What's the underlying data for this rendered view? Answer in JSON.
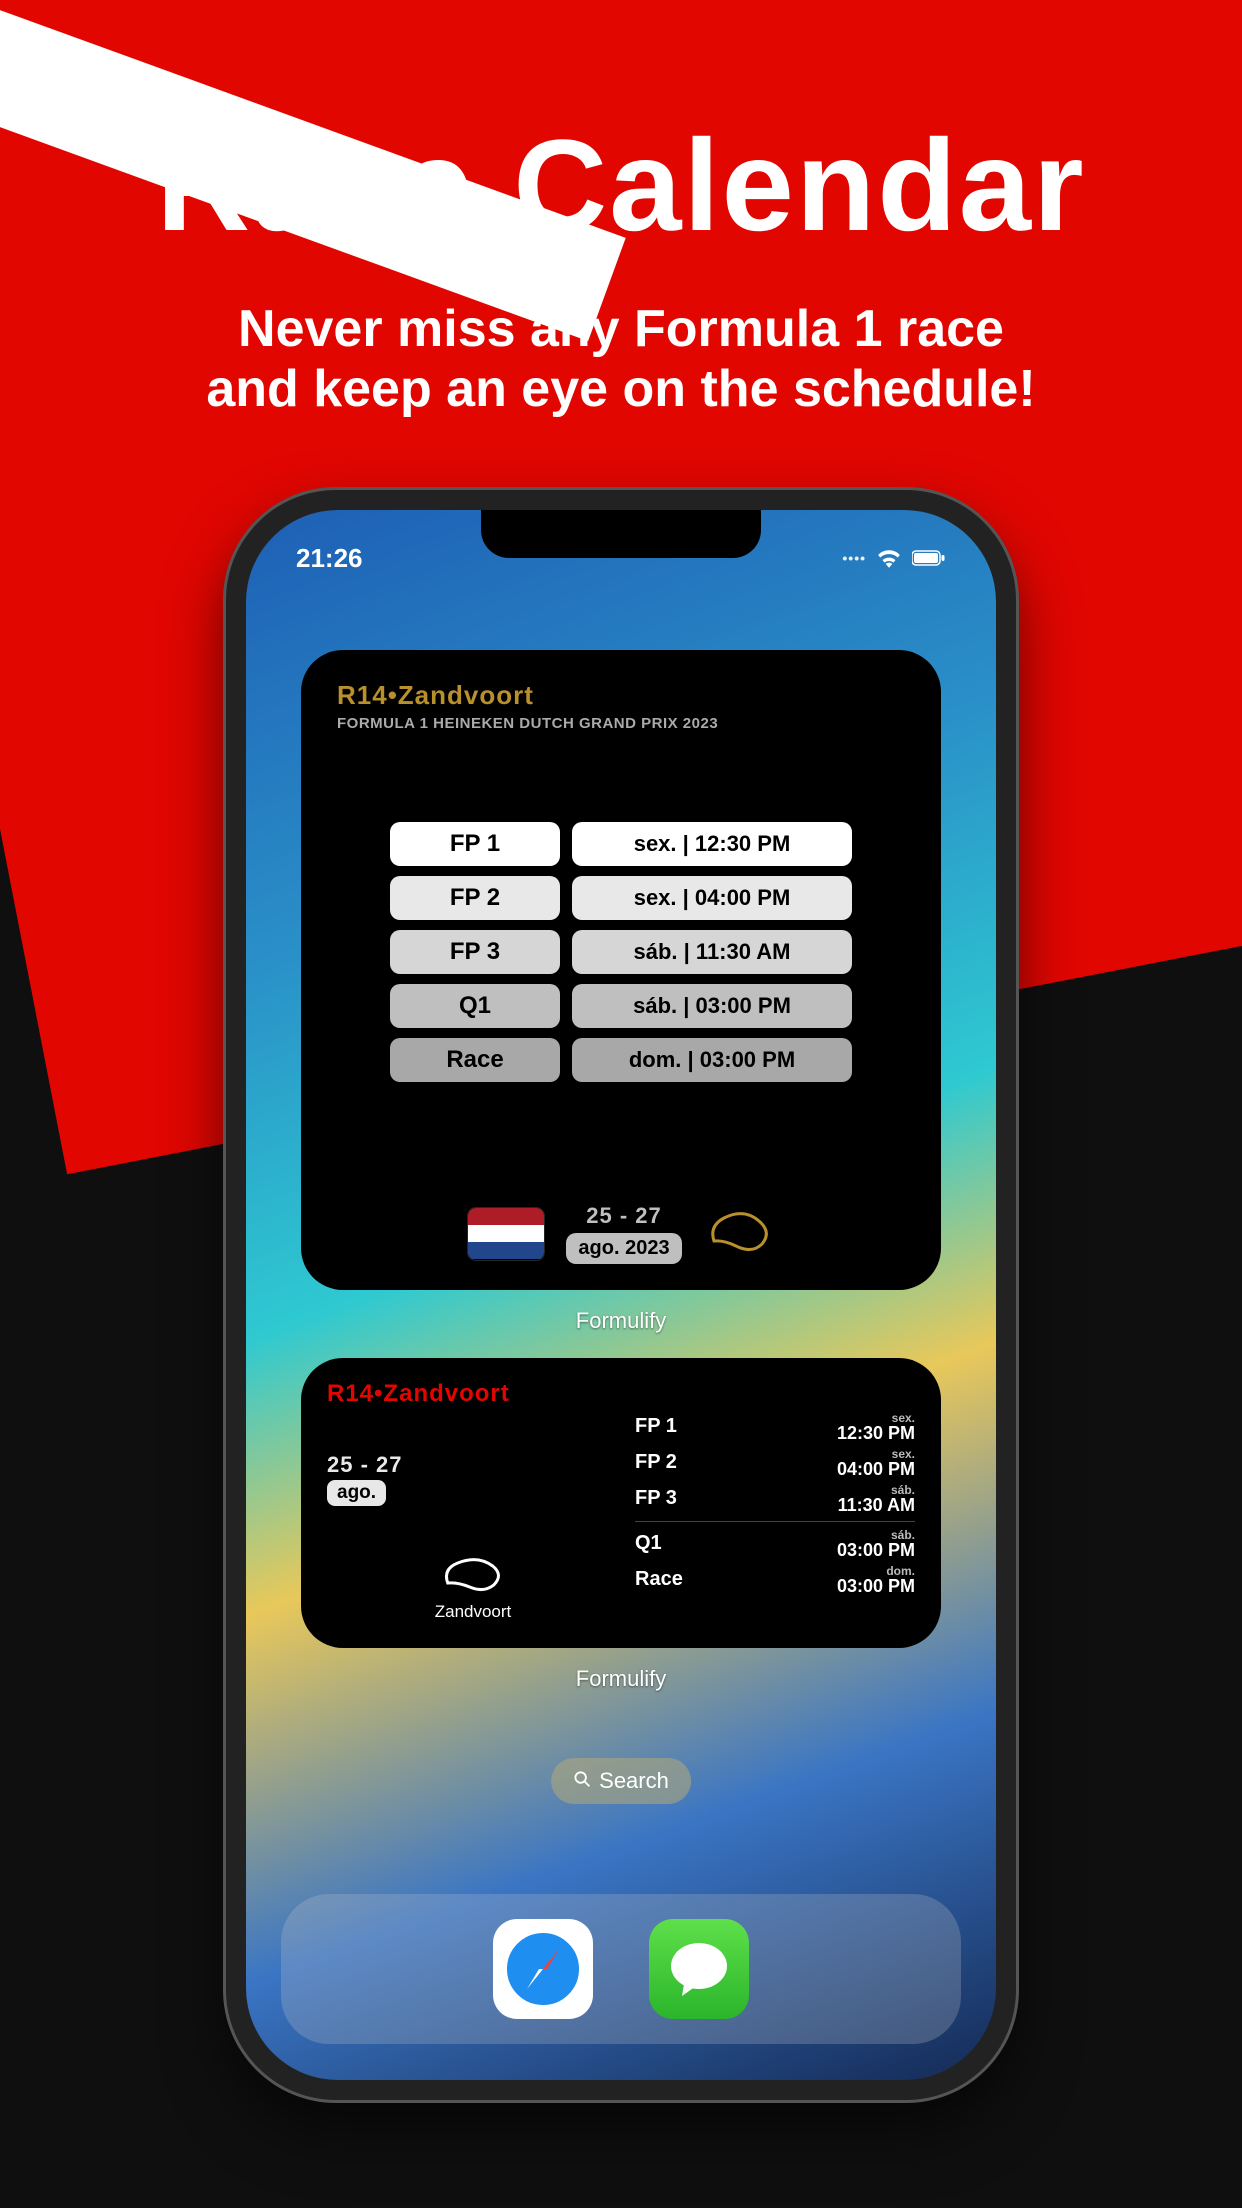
{
  "hero": {
    "title": "Race Calendar",
    "subtitle_line1": "Never miss any Formula 1 race",
    "subtitle_line2": "and keep an eye on the schedule!"
  },
  "status": {
    "time": "21:26"
  },
  "widget_large": {
    "title": "R14•Zandvoort",
    "subtitle": "FORMULA 1 HEINEKEN DUTCH GRAND PRIX 2023",
    "sessions": [
      {
        "name": "FP 1",
        "time": "sex. | 12:30 PM"
      },
      {
        "name": "FP 2",
        "time": "sex. | 04:00 PM"
      },
      {
        "name": "FP 3",
        "time": "sáb. | 11:30 AM"
      },
      {
        "name": "Q1",
        "time": "sáb. | 03:00 PM"
      },
      {
        "name": "Race",
        "time": "dom. | 03:00 PM"
      }
    ],
    "date_range": "25 - 27",
    "date_month": "ago. 2023",
    "label": "Formulify"
  },
  "widget_small": {
    "title": "R14•Zandvoort",
    "date_range": "25 - 27",
    "date_month": "ago.",
    "track_name": "Zandvoort",
    "sessions_top": [
      {
        "name": "FP 1",
        "day": "sex.",
        "time": "12:30 PM"
      },
      {
        "name": "FP 2",
        "day": "sex.",
        "time": "04:00 PM"
      },
      {
        "name": "FP 3",
        "day": "sáb.",
        "time": "11:30 AM"
      }
    ],
    "sessions_bot": [
      {
        "name": "Q1",
        "day": "sáb.",
        "time": "03:00 PM"
      },
      {
        "name": "Race",
        "day": "dom.",
        "time": "03:00 PM"
      }
    ],
    "label": "Formulify"
  },
  "search": {
    "label": "Search"
  }
}
